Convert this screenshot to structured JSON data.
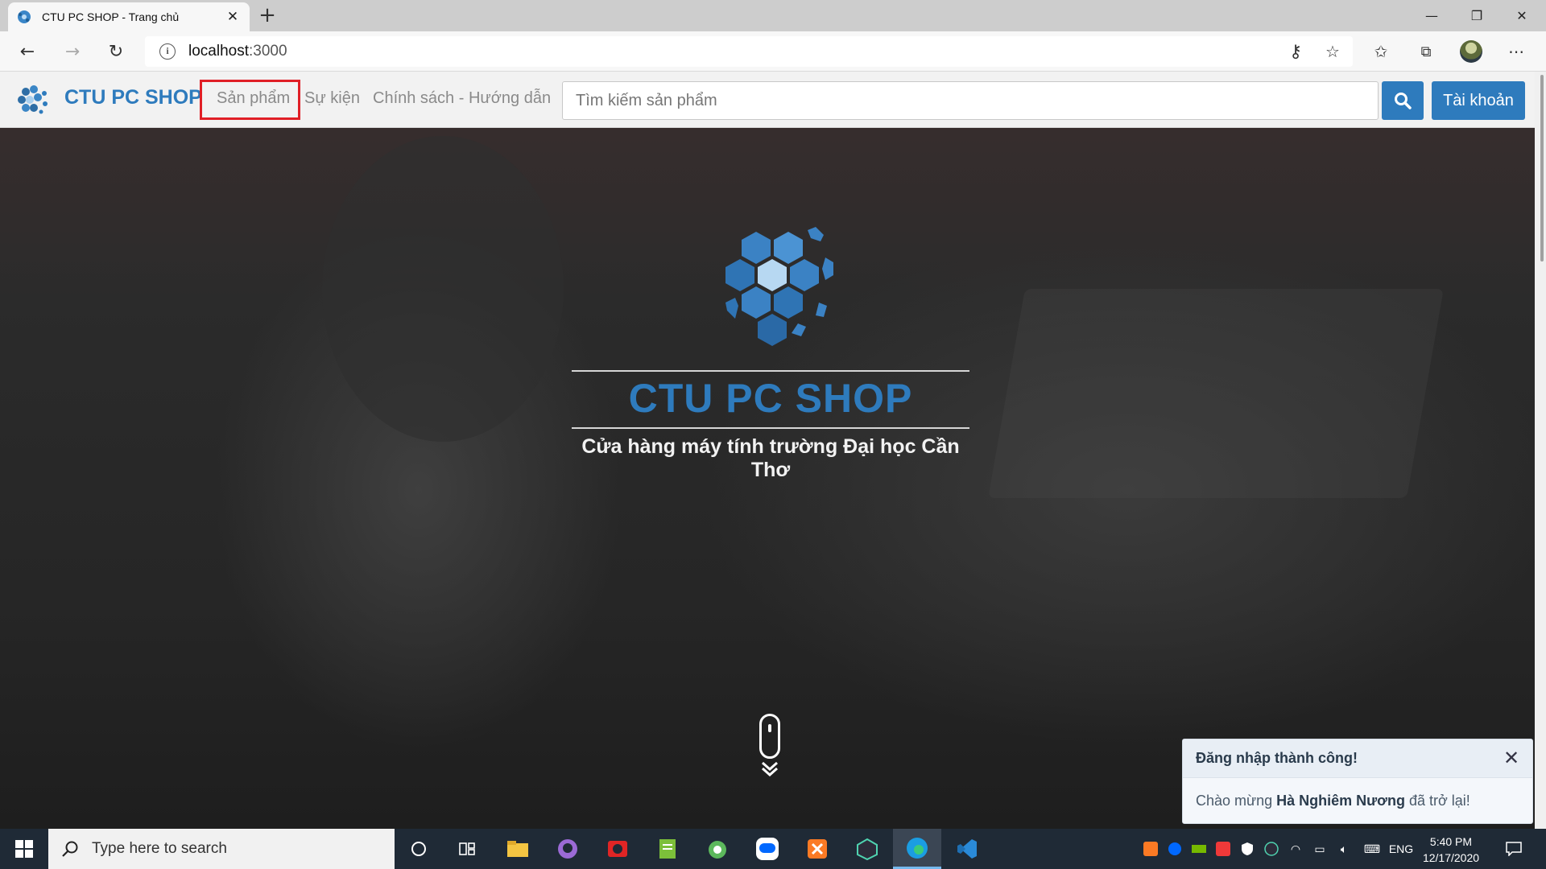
{
  "browser": {
    "tab_title": "CTU PC SHOP - Trang chủ",
    "url_host": "localhost",
    "url_port": ":3000"
  },
  "nav": {
    "brand": "CTU PC SHOP",
    "links": [
      "Sản phẩm",
      "Sự kiện",
      "Chính sách - Hướng dẫn"
    ],
    "search_placeholder": "Tìm kiếm sản phẩm",
    "account_label": "Tài khoản"
  },
  "hero": {
    "title": "CTU PC SHOP",
    "subtitle": "Cửa hàng máy tính trường Đại học Cần Thơ"
  },
  "toast": {
    "title": "Đăng nhập thành công!",
    "msg_before": "Chào mừng ",
    "user_name": "Hà Nghiêm Nương",
    "msg_after": " đã trở lại!"
  },
  "taskbar": {
    "search_placeholder": "Type here to search",
    "language": "ENG",
    "time": "5:40 PM",
    "date": "12/17/2020"
  },
  "colors": {
    "brand_blue": "#2e7bbd",
    "highlight_red": "#e01f26"
  }
}
